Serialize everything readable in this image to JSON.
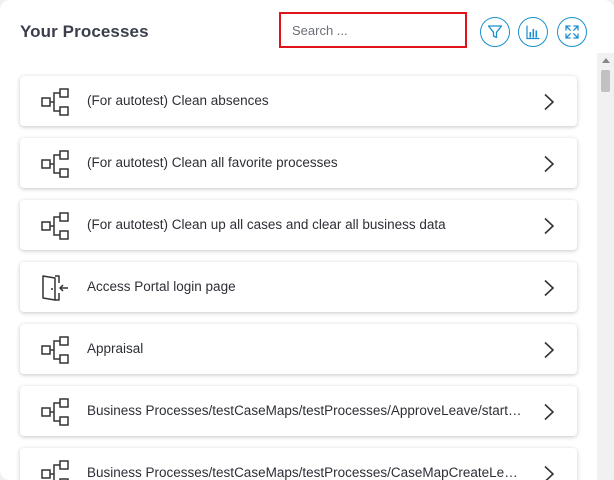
{
  "header": {
    "title": "Your Processes",
    "search_placeholder": "Search ...",
    "buttons": [
      "filter-icon",
      "bar-chart-icon",
      "expand-icon"
    ]
  },
  "colors": {
    "accent": "#1c8fcf",
    "search_border": "#e0131a",
    "text": "#2d2f36"
  },
  "processes": [
    {
      "label": "(For autotest) Clean absences",
      "icon": "process-flow-icon"
    },
    {
      "label": "(For autotest) Clean all favorite processes",
      "icon": "process-flow-icon"
    },
    {
      "label": "(For autotest) Clean up all cases and clear all business data",
      "icon": "process-flow-icon"
    },
    {
      "label": "Access Portal login page",
      "icon": "login-door-icon"
    },
    {
      "label": "Appraisal",
      "icon": "process-flow-icon"
    },
    {
      "label": "Business Processes/testCaseMaps/testProcesses/ApproveLeave/start.i...",
      "icon": "process-flow-icon"
    },
    {
      "label": "Business Processes/testCaseMaps/testProcesses/CaseMapCreateLeav...",
      "icon": "process-flow-icon"
    }
  ]
}
